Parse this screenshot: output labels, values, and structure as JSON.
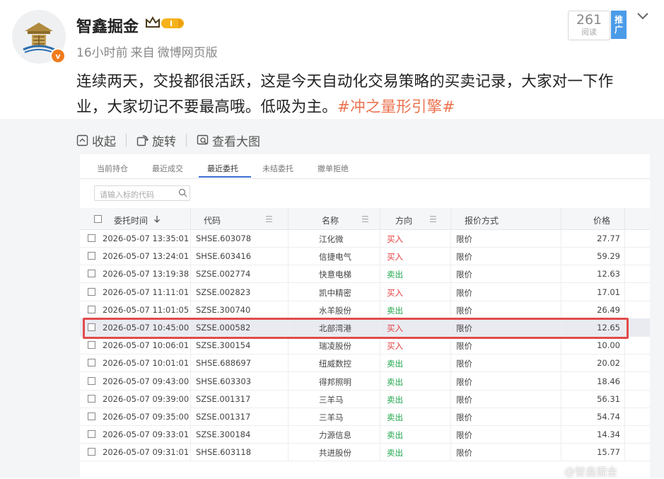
{
  "post": {
    "username": "智鑫掘金",
    "level_badge": "I",
    "time": "16小时前",
    "source_prefix": "来自",
    "source": "微博网页版",
    "read_count": "261",
    "read_label": "阅读",
    "promote_label_1": "推",
    "promote_label_2": "广",
    "text_main": "连续两天，交投都很活跃，这是今天自动化交易策略的买卖记录，大家对一下作业，大家切记不要最高哦。低吸为主。",
    "hashtag": "#冲之量形引擎#"
  },
  "media_toolbar": {
    "collapse_label": "收起",
    "rotate_label": "旋转",
    "view_large_label": "查看大图"
  },
  "screenshot": {
    "tabs": [
      "当前持仓",
      "最近成交",
      "最近委托",
      "未结委托",
      "撤单拒绝"
    ],
    "active_tab": "最近委托",
    "search_placeholder": "请输入标的代码",
    "columns": {
      "time": "委托时间",
      "code": "代码",
      "name": "名称",
      "direction": "方向",
      "price_type": "报价方式",
      "price": "价格"
    },
    "rows": [
      {
        "time": "2026-05-07 13:35:01",
        "code": "SHSE.603078",
        "name": "江化微",
        "direction": "买入",
        "type": "限价",
        "price": "27.77"
      },
      {
        "time": "2026-05-07 13:24:01",
        "code": "SHSE.603416",
        "name": "信捷电气",
        "direction": "买入",
        "type": "限价",
        "price": "59.29"
      },
      {
        "time": "2026-05-07 13:19:38",
        "code": "SZSE.002774",
        "name": "快意电梯",
        "direction": "卖出",
        "type": "限价",
        "price": "12.63"
      },
      {
        "time": "2026-05-07 11:11:01",
        "code": "SZSE.002823",
        "name": "凯中精密",
        "direction": "买入",
        "type": "限价",
        "price": "17.01"
      },
      {
        "time": "2026-05-07 11:01:05",
        "code": "SZSE.300740",
        "name": "水羊股份",
        "direction": "卖出",
        "type": "限价",
        "price": "26.49"
      },
      {
        "time": "2026-05-07 10:45:00",
        "code": "SZSE.000582",
        "name": "北部湾港",
        "direction": "买入",
        "type": "限价",
        "price": "12.65"
      },
      {
        "time": "2026-05-07 10:06:01",
        "code": "SZSE.300154",
        "name": "瑞凌股份",
        "direction": "买入",
        "type": "限价",
        "price": "10.00"
      },
      {
        "time": "2026-05-07 10:01:01",
        "code": "SHSE.688697",
        "name": "纽威数控",
        "direction": "卖出",
        "type": "限价",
        "price": "20.02"
      },
      {
        "time": "2026-05-07 09:43:00",
        "code": "SHSE.603303",
        "name": "得邦照明",
        "direction": "卖出",
        "type": "限价",
        "price": "18.46"
      },
      {
        "time": "2026-05-07 09:39:00",
        "code": "SZSE.001317",
        "name": "三羊马",
        "direction": "卖出",
        "type": "限价",
        "price": "56.31"
      },
      {
        "time": "2026-05-07 09:35:00",
        "code": "SZSE.001317",
        "name": "三羊马",
        "direction": "卖出",
        "type": "限价",
        "price": "54.74"
      },
      {
        "time": "2026-05-07 09:33:01",
        "code": "SZSE.300184",
        "name": "力源信息",
        "direction": "卖出",
        "type": "限价",
        "price": "14.34"
      },
      {
        "time": "2026-05-07 09:31:01",
        "code": "SHSE.603118",
        "name": "共进股份",
        "direction": "卖出",
        "type": "限价",
        "price": "15.77"
      }
    ],
    "highlighted_row": "北部湾港"
  },
  "watermark": "@智鑫掘金",
  "colors": {
    "buy": "#e43a3a",
    "sell": "#1ea64a",
    "hashtag": "#eb7350",
    "highlight_border": "#e24b4b",
    "verified_badge": "#f07c1e",
    "promote": "#4a9be8"
  },
  "icons": [
    "verified-v-icon",
    "crown-icon",
    "collapse-icon",
    "rotate-icon",
    "view-large-icon",
    "search-icon",
    "sort-down-icon",
    "column-menu-icon",
    "chevron-down-icon"
  ]
}
